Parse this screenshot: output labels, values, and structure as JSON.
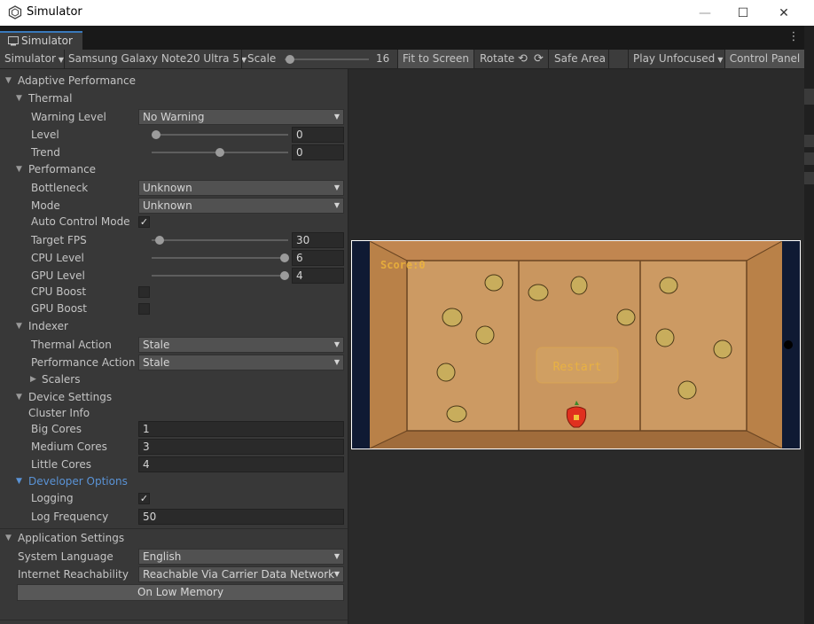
{
  "window": {
    "title": "Simulator",
    "minimize": "—",
    "maximize": "☐",
    "close": "✕"
  },
  "tab": {
    "label": "Simulator"
  },
  "toolbar": {
    "simulator_menu": "Simulator",
    "device": "Samsung Galaxy Note20 Ultra 5",
    "scale_label": "Scale",
    "scale_value": "16",
    "fit_to_screen": "Fit to Screen",
    "rotate": "Rotate",
    "safe_area": "Safe Area",
    "play_mode": "Play Unfocused",
    "control_panel": "Control Panel"
  },
  "panel": {
    "adaptive_performance": "Adaptive Performance",
    "thermal": {
      "header": "Thermal",
      "warning_level_label": "Warning Level",
      "warning_level_value": "No Warning",
      "level_label": "Level",
      "level_value": "0",
      "level_fraction": 0.0,
      "trend_label": "Trend",
      "trend_value": "0",
      "trend_fraction": 0.5
    },
    "performance": {
      "header": "Performance",
      "bottleneck_label": "Bottleneck",
      "bottleneck_value": "Unknown",
      "mode_label": "Mode",
      "mode_value": "Unknown",
      "auto_control_label": "Auto Control Mode",
      "auto_control_checked": true,
      "target_fps_label": "Target FPS",
      "target_fps_value": "30",
      "target_fps_fraction": 0.05,
      "cpu_level_label": "CPU Level",
      "cpu_level_value": "6",
      "cpu_level_fraction": 1.0,
      "gpu_level_label": "GPU Level",
      "gpu_level_value": "4",
      "gpu_level_fraction": 1.0,
      "cpu_boost_label": "CPU Boost",
      "gpu_boost_label": "GPU Boost"
    },
    "indexer": {
      "header": "Indexer",
      "thermal_action_label": "Thermal Action",
      "thermal_action_value": "Stale",
      "performance_action_label": "Performance Action",
      "performance_action_value": "Stale",
      "scalers_label": "Scalers"
    },
    "device_settings": {
      "header": "Device Settings",
      "cluster_info": "Cluster Info",
      "big_cores_label": "Big Cores",
      "big_cores_value": "1",
      "medium_cores_label": "Medium Cores",
      "medium_cores_value": "3",
      "little_cores_label": "Little Cores",
      "little_cores_value": "4"
    },
    "developer_options": {
      "header": "Developer Options",
      "logging_label": "Logging",
      "logging_checked": true,
      "log_frequency_label": "Log Frequency",
      "log_frequency_value": "50"
    },
    "application_settings": {
      "header": "Application Settings",
      "system_language_label": "System Language",
      "system_language_value": "English",
      "internet_label": "Internet Reachability",
      "internet_value": "Reachable Via Carrier Data Network",
      "low_memory_button": "On Low Memory"
    }
  },
  "game": {
    "score_text": "Score:0",
    "restart_label": "Restart",
    "colors": {
      "floor": "#c9965f",
      "wall": "#b07a45",
      "letterbox": "#0f1a33",
      "ui_text": "#f0b73a"
    }
  },
  "colors": {
    "accent_blue": "#5a93d6",
    "panel_bg": "#383838",
    "toolbar_bg": "#3c3c3c"
  }
}
